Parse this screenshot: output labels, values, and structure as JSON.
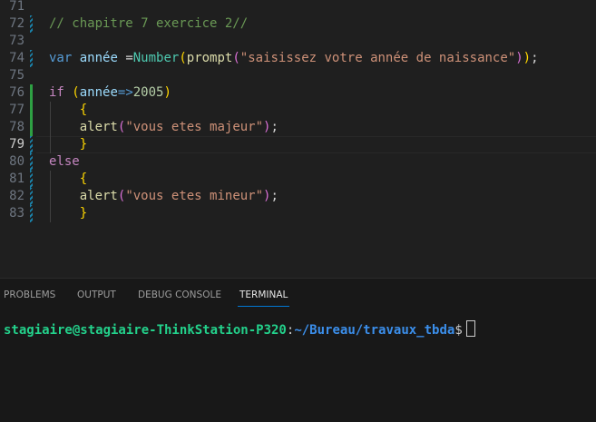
{
  "colors": {
    "comment": "#6a9955",
    "keyword": "#569cd6",
    "control": "#c586c0",
    "variable": "#9cdcfe",
    "function": "#dcdcaa",
    "class": "#4ec9b0",
    "string": "#ce9178",
    "bracket1": "#ffd700",
    "bracket2": "#da70d6",
    "number": "#b5cea8",
    "punct": "#d4d4d4"
  },
  "editor": {
    "current_line": "79",
    "lines": [
      {
        "n": "71",
        "deco": "",
        "tokens": []
      },
      {
        "n": "72",
        "deco": "mod",
        "tokens": [
          {
            "t": "// chapitre 7 exercice 2//",
            "c": "comment"
          }
        ]
      },
      {
        "n": "73",
        "deco": "",
        "tokens": []
      },
      {
        "n": "74",
        "deco": "mod",
        "tokens": [
          {
            "t": "var",
            "c": "keyword"
          },
          {
            "t": " ",
            "c": "punct"
          },
          {
            "t": "année",
            "c": "variable"
          },
          {
            "t": " =",
            "c": "punct"
          },
          {
            "t": "Number",
            "c": "class"
          },
          {
            "t": "(",
            "c": "bracket1"
          },
          {
            "t": "prompt",
            "c": "function"
          },
          {
            "t": "(",
            "c": "bracket2"
          },
          {
            "t": "\"saisissez votre année de naissance\"",
            "c": "string"
          },
          {
            "t": ")",
            "c": "bracket2"
          },
          {
            "t": ")",
            "c": "bracket1"
          },
          {
            "t": ";",
            "c": "punct"
          }
        ]
      },
      {
        "n": "75",
        "deco": "",
        "tokens": []
      },
      {
        "n": "76",
        "deco": "add",
        "tokens": [
          {
            "t": "if",
            "c": "control"
          },
          {
            "t": " ",
            "c": "punct"
          },
          {
            "t": "(",
            "c": "bracket1"
          },
          {
            "t": "année",
            "c": "variable"
          },
          {
            "t": "=>",
            "c": "keyword"
          },
          {
            "t": "2005",
            "c": "number"
          },
          {
            "t": ")",
            "c": "bracket1"
          }
        ]
      },
      {
        "n": "77",
        "deco": "add",
        "tokens": [
          {
            "t": "    ",
            "c": "punct"
          },
          {
            "t": "{",
            "c": "bracket1"
          }
        ]
      },
      {
        "n": "78",
        "deco": "add",
        "tokens": [
          {
            "t": "    ",
            "c": "punct"
          },
          {
            "t": "alert",
            "c": "function"
          },
          {
            "t": "(",
            "c": "bracket2"
          },
          {
            "t": "\"vous etes majeur\"",
            "c": "string"
          },
          {
            "t": ")",
            "c": "bracket2"
          },
          {
            "t": ";",
            "c": "punct"
          }
        ]
      },
      {
        "n": "79",
        "deco": "mod",
        "tokens": [
          {
            "t": "    ",
            "c": "punct"
          },
          {
            "t": "}",
            "c": "bracket1"
          }
        ]
      },
      {
        "n": "80",
        "deco": "mod",
        "tokens": [
          {
            "t": "else",
            "c": "control"
          }
        ]
      },
      {
        "n": "81",
        "deco": "mod",
        "tokens": [
          {
            "t": "    ",
            "c": "punct"
          },
          {
            "t": "{",
            "c": "bracket1"
          }
        ]
      },
      {
        "n": "82",
        "deco": "mod",
        "tokens": [
          {
            "t": "    ",
            "c": "punct"
          },
          {
            "t": "alert",
            "c": "function"
          },
          {
            "t": "(",
            "c": "bracket2"
          },
          {
            "t": "\"vous etes mineur\"",
            "c": "string"
          },
          {
            "t": ")",
            "c": "bracket2"
          },
          {
            "t": ";",
            "c": "punct"
          }
        ]
      },
      {
        "n": "83",
        "deco": "mod",
        "tokens": [
          {
            "t": "    ",
            "c": "punct"
          },
          {
            "t": "}",
            "c": "bracket1"
          }
        ]
      }
    ]
  },
  "panel": {
    "tabs": [
      {
        "label": "PROBLEMS"
      },
      {
        "label": "OUTPUT"
      },
      {
        "label": "DEBUG CONSOLE"
      },
      {
        "label": "TERMINAL",
        "active": true
      }
    ],
    "terminal": {
      "user_host": "stagiaire@stagiaire-ThinkStation-P320",
      "sep": ":",
      "path": "~/Bureau/travaux_tbda",
      "prompt": "$",
      "user_color": "#23d18b",
      "path_color": "#3b8eea"
    }
  }
}
